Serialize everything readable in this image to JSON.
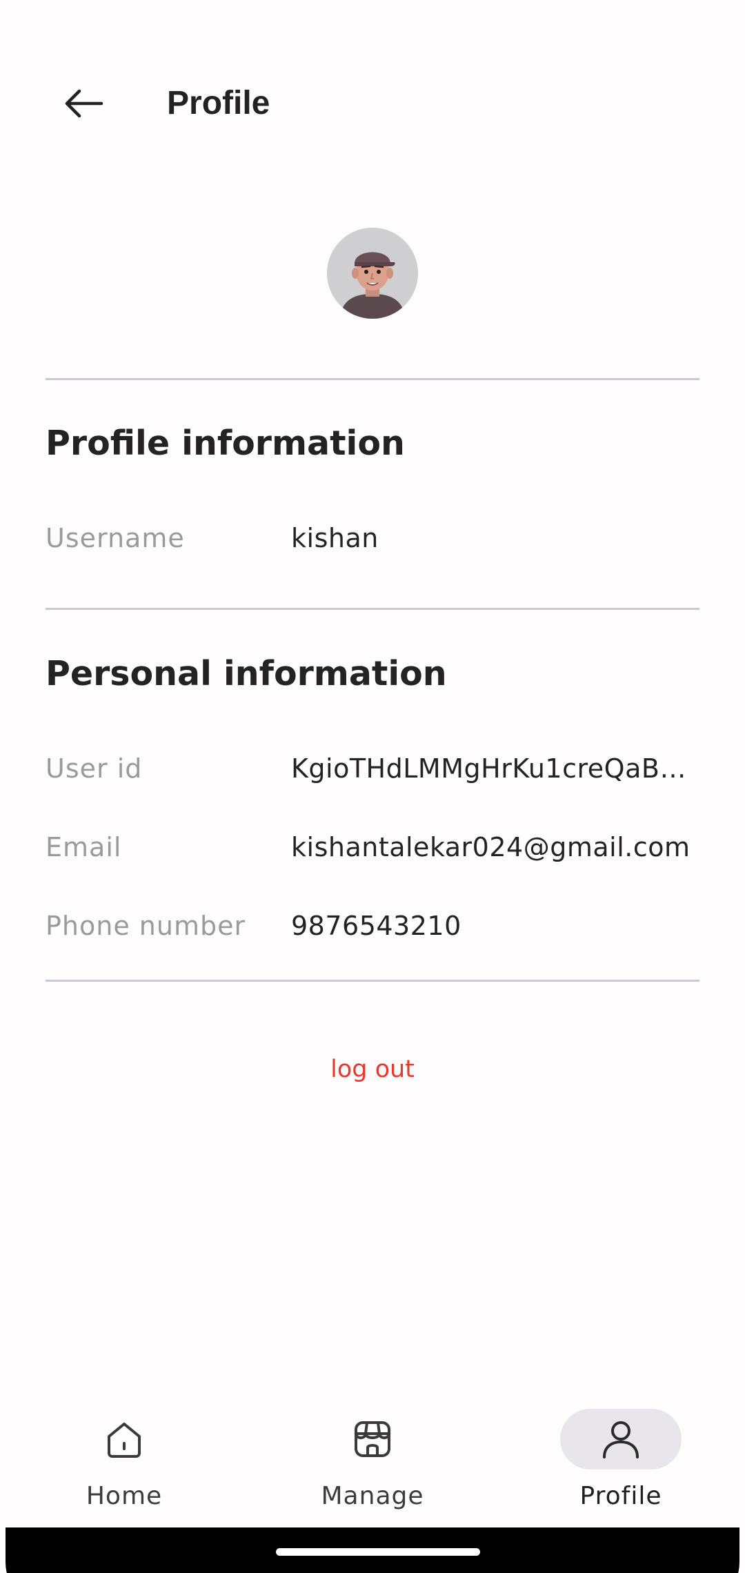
{
  "header": {
    "title": "Profile",
    "back_icon": "arrow-left-icon"
  },
  "avatar": {
    "icon": "avatar-3d-man-cap"
  },
  "profile_info": {
    "title": "Profile information",
    "rows": [
      {
        "label": "Username",
        "value": "kishan"
      }
    ]
  },
  "personal_info": {
    "title": "Personal information",
    "rows": [
      {
        "label": "User id",
        "value": "KgioTHdLMMgHrKu1creQaBd…"
      },
      {
        "label": "Email",
        "value": "kishantalekar024@gmail.com"
      },
      {
        "label": "Phone number",
        "value": "9876543210"
      }
    ]
  },
  "actions": {
    "logout_label": "log out",
    "logout_color": "#e53a2c"
  },
  "bottom_nav": {
    "items": [
      {
        "label": "Home",
        "icon": "home-icon",
        "active": false
      },
      {
        "label": "Manage",
        "icon": "store-icon",
        "active": false
      },
      {
        "label": "Profile",
        "icon": "person-icon",
        "active": true
      }
    ],
    "active_pill_color": "#e8e6ea"
  }
}
